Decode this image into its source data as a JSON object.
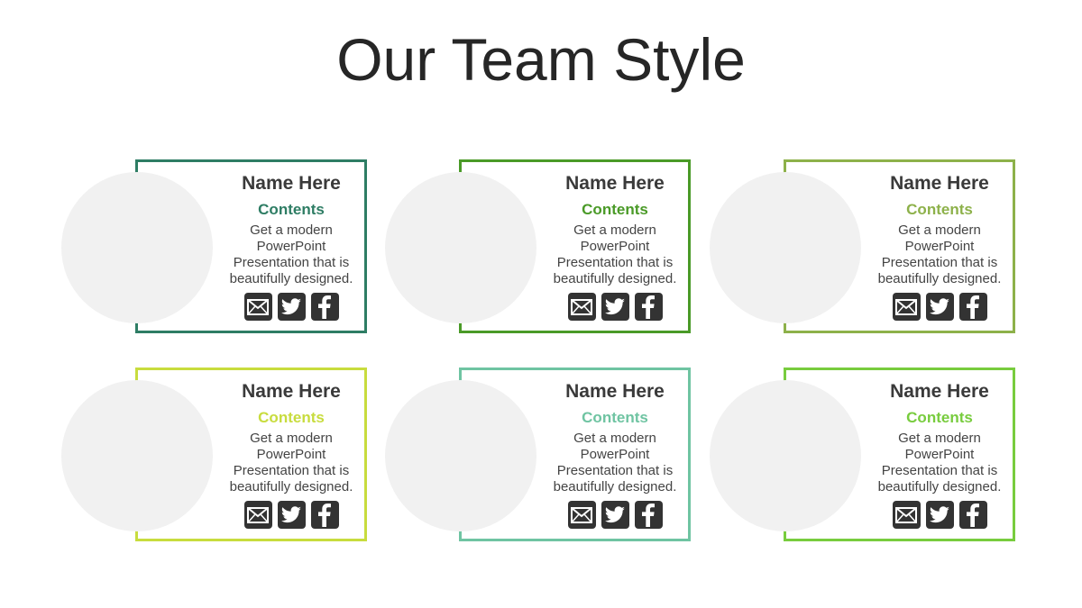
{
  "title": "Our Team Style",
  "cards": [
    {
      "name": "Name Here",
      "contents": "Contents",
      "desc_lines": [
        "Get a modern",
        "PowerPoint",
        "Presentation that is",
        "beautifully designed."
      ],
      "color": "#2e7d64"
    },
    {
      "name": "Name Here",
      "contents": "Contents",
      "desc_lines": [
        "Get a modern",
        "PowerPoint",
        "Presentation that is",
        "beautifully designed."
      ],
      "color": "#4a9a27"
    },
    {
      "name": "Name Here",
      "contents": "Contents",
      "desc_lines": [
        "Get a modern",
        "PowerPoint",
        "Presentation that is",
        "beautifully designed."
      ],
      "color": "#8db14a"
    },
    {
      "name": "Name Here",
      "contents": "Contents",
      "desc_lines": [
        "Get a modern",
        "PowerPoint",
        "Presentation that is",
        "beautifully designed."
      ],
      "color": "#c8dc3e"
    },
    {
      "name": "Name Here",
      "contents": "Contents",
      "desc_lines": [
        "Get a modern",
        "PowerPoint",
        "Presentation that is",
        "beautifully designed."
      ],
      "color": "#6fc4a2"
    },
    {
      "name": "Name Here",
      "contents": "Contents",
      "desc_lines": [
        "Get a modern",
        "PowerPoint",
        "Presentation that is",
        "beautifully designed."
      ],
      "color": "#78cc3e"
    }
  ],
  "social_icons": [
    "mail-icon",
    "twitter-icon",
    "facebook-icon"
  ]
}
